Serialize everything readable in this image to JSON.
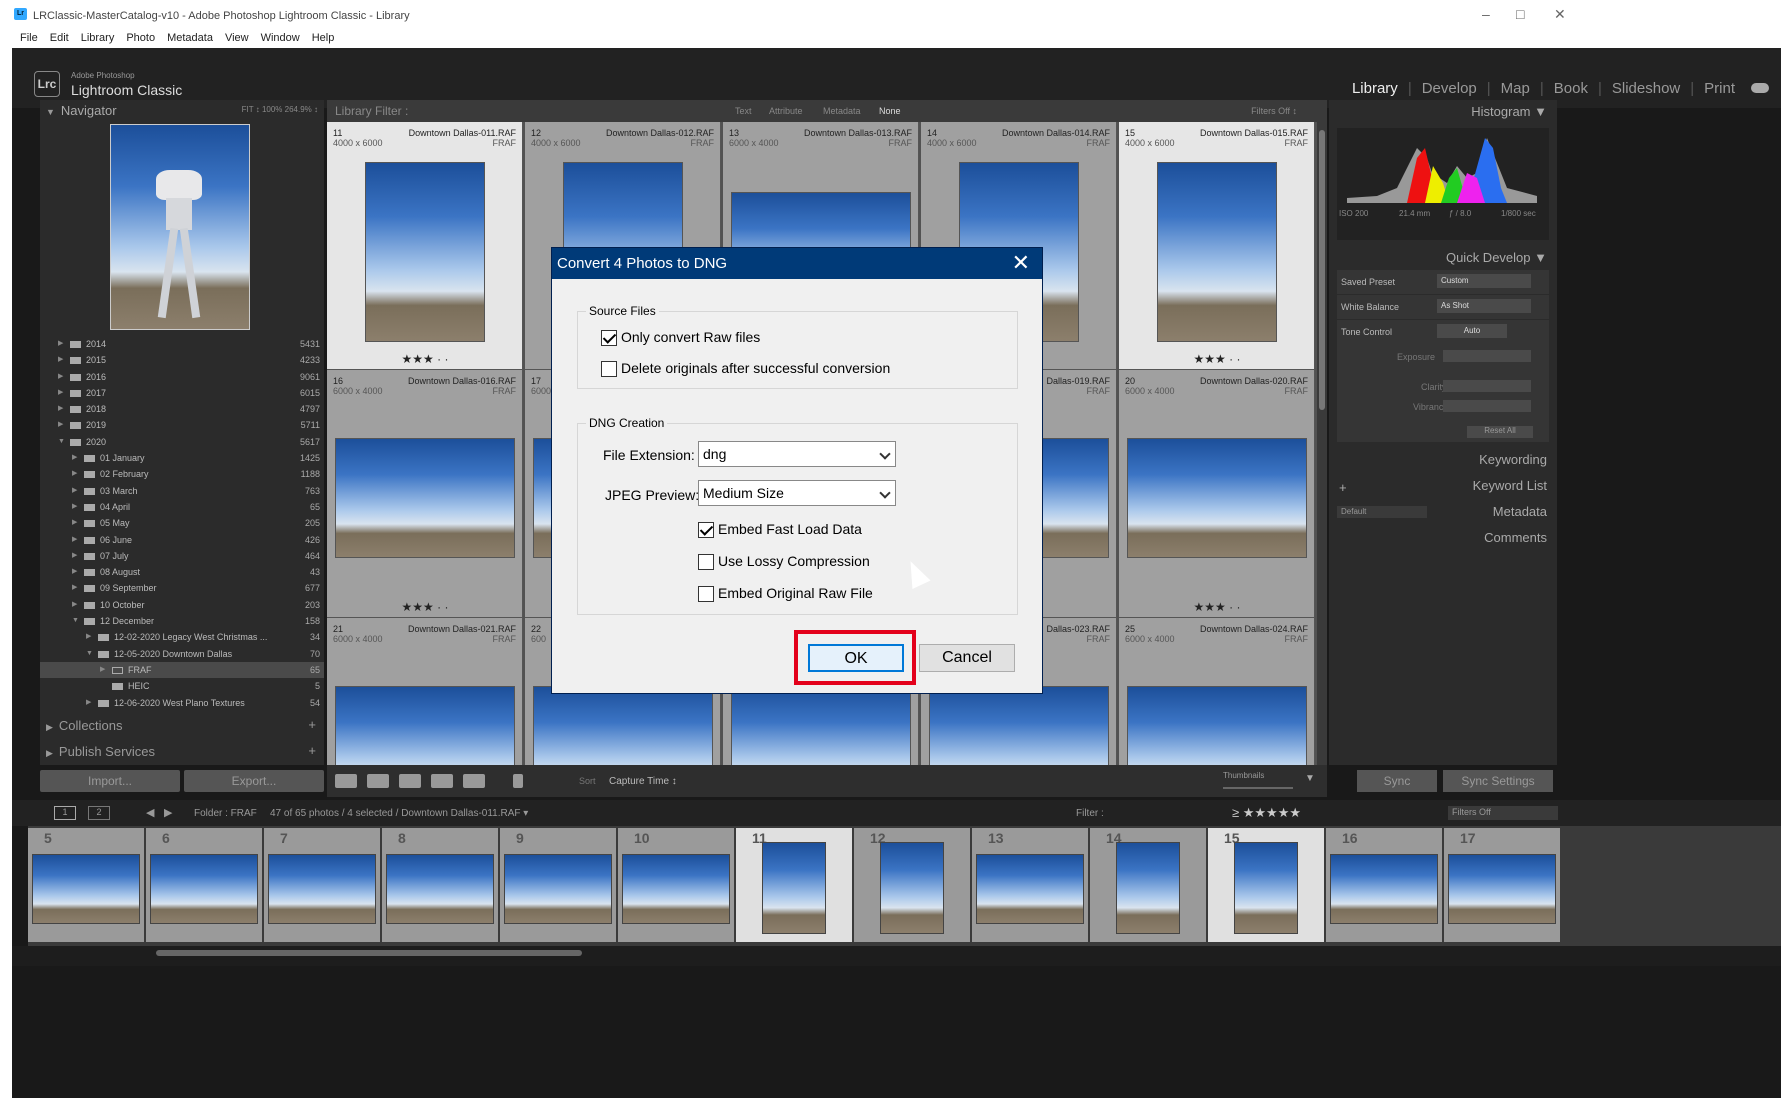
{
  "window": {
    "title": "LRClassic-MasterCatalog-v10 - Adobe Photoshop Lightroom Classic - Library",
    "minimize": "–",
    "maximize": "□",
    "close": "✕"
  },
  "menu": [
    "File",
    "Edit",
    "Library",
    "Photo",
    "Metadata",
    "View",
    "Window",
    "Help"
  ],
  "identity": {
    "small": "Adobe Photoshop",
    "big": "Lightroom Classic",
    "badge": "Lrc"
  },
  "modules": [
    "Library",
    "Develop",
    "Map",
    "Book",
    "Slideshow",
    "Print"
  ],
  "active_module": "Library",
  "navigator": {
    "label": "Navigator",
    "zoom": "FIT ↕  100%  264.9% ↕"
  },
  "folders": [
    {
      "label": "2014",
      "count": "5431",
      "level": 1
    },
    {
      "label": "2015",
      "count": "4233",
      "level": 1
    },
    {
      "label": "2016",
      "count": "9061",
      "level": 1
    },
    {
      "label": "2017",
      "count": "6015",
      "level": 1
    },
    {
      "label": "2018",
      "count": "4797",
      "level": 1
    },
    {
      "label": "2019",
      "count": "5711",
      "level": 1
    },
    {
      "label": "2020",
      "count": "5617",
      "level": 1
    },
    {
      "label": "01 January",
      "count": "1425",
      "level": 2
    },
    {
      "label": "02 February",
      "count": "1188",
      "level": 2
    },
    {
      "label": "03 March",
      "count": "763",
      "level": 2
    },
    {
      "label": "04 April",
      "count": "65",
      "level": 2
    },
    {
      "label": "05 May",
      "count": "205",
      "level": 2
    },
    {
      "label": "06 June",
      "count": "426",
      "level": 2
    },
    {
      "label": "07 July",
      "count": "464",
      "level": 2
    },
    {
      "label": "08 August",
      "count": "43",
      "level": 2
    },
    {
      "label": "09 September",
      "count": "677",
      "level": 2
    },
    {
      "label": "10 October",
      "count": "203",
      "level": 2
    },
    {
      "label": "12 December",
      "count": "158",
      "level": 2
    },
    {
      "label": "12-02-2020 Legacy West Christmas ...",
      "count": "34",
      "level": 3
    },
    {
      "label": "12-05-2020 Downtown Dallas",
      "count": "70",
      "level": 3
    },
    {
      "label": "FRAF",
      "count": "65",
      "level": 4
    },
    {
      "label": "HEIC",
      "count": "5",
      "level": 4
    },
    {
      "label": "12-06-2020 West Plano Textures",
      "count": "54",
      "level": 3
    }
  ],
  "left_panels": {
    "collections": "Collections",
    "publish": "Publish Services",
    "import": "Import...",
    "export": "Export..."
  },
  "library_filter": {
    "label": "Library Filter :",
    "tabs": [
      "Text",
      "Attribute",
      "Metadata",
      "None"
    ],
    "filters_off": "Filters Off ↕"
  },
  "grid": [
    {
      "num": "11",
      "dims": "4000 x 6000",
      "name": "Downtown Dallas-011.RAF",
      "type": "FRAF",
      "stars": "★★★ · ·",
      "state": "sel"
    },
    {
      "num": "12",
      "dims": "4000 x 6000",
      "name": "Downtown Dallas-012.RAF",
      "type": "FRAF",
      "stars": "",
      "state": "semi"
    },
    {
      "num": "13",
      "dims": "6000 x 4000",
      "name": "Downtown Dallas-013.RAF",
      "type": "FRAF",
      "stars": "",
      "state": "semi"
    },
    {
      "num": "14",
      "dims": "4000 x 6000",
      "name": "Downtown Dallas-014.RAF",
      "type": "FRAF",
      "stars": "",
      "state": "semi"
    },
    {
      "num": "15",
      "dims": "4000 x 6000",
      "name": "Downtown Dallas-015.RAF",
      "type": "FRAF",
      "stars": "★★★ · ·",
      "state": "sel"
    },
    {
      "num": "16",
      "dims": "6000 x 4000",
      "name": "Downtown Dallas-016.RAF",
      "type": "FRAF",
      "stars": "★★★ · ·",
      "state": "semi"
    },
    {
      "num": "17",
      "dims": "6000",
      "name": "",
      "type": "",
      "stars": "",
      "state": "semi"
    },
    {
      "num": "",
      "dims": "",
      "name": "",
      "type": "",
      "stars": "",
      "state": "semi"
    },
    {
      "num": "",
      "dims": "",
      "name": "Dallas-019.RAF",
      "type": "FRAF",
      "stars": "",
      "state": "semi"
    },
    {
      "num": "20",
      "dims": "6000 x 4000",
      "name": "Downtown Dallas-020.RAF",
      "type": "FRAF",
      "stars": "★★★ · ·",
      "state": "semi"
    },
    {
      "num": "21",
      "dims": "6000 x 4000",
      "name": "Downtown Dallas-021.RAF",
      "type": "FRAF",
      "stars": "",
      "state": "semi"
    },
    {
      "num": "22",
      "dims": "600",
      "name": "",
      "type": "",
      "stars": "",
      "state": "semi"
    },
    {
      "num": "",
      "dims": "",
      "name": "",
      "type": "",
      "stars": "",
      "state": "semi"
    },
    {
      "num": "",
      "dims": "",
      "name": "Dallas-023.RAF",
      "type": "FRAF",
      "stars": "",
      "state": "semi"
    },
    {
      "num": "25",
      "dims": "6000 x 4000",
      "name": "Downtown Dallas-024.RAF",
      "type": "FRAF",
      "stars": "",
      "state": "semi"
    }
  ],
  "toolbar": {
    "sort_label": "Sort",
    "sort_value": "Capture Time ↕",
    "thumbnails": "Thumbnails"
  },
  "right_panel": {
    "histogram": "Histogram",
    "info": [
      "ISO 200",
      "21.4 mm",
      "ƒ / 8.0",
      "1/800 sec"
    ],
    "quick_develop": "Quick Develop",
    "saved_preset_label": "Saved Preset",
    "saved_preset_value": "Custom",
    "white_balance_label": "White Balance",
    "white_balance_value": "As Shot",
    "tone_control_label": "Tone Control",
    "tone_control_value": "Auto",
    "exposure": "Exposure",
    "clarity": "Clarity",
    "vibrance": "Vibrance",
    "reset_all": "Reset All",
    "keywording": "Keywording",
    "keyword_list": "Keyword List",
    "metadata": "Metadata",
    "metadata_preset": "Default",
    "comments": "Comments",
    "sync": "Sync",
    "sync_settings": "Sync Settings"
  },
  "filmstrip": {
    "source": "Folder : FRAF",
    "count": "47 of 65 photos / 4 selected / Downtown Dallas-011.RAF ▾",
    "filter_label": "Filter :",
    "filters_off": "Filters Off",
    "pages": [
      "1",
      "2"
    ],
    "frames": [
      "5",
      "6",
      "7",
      "8",
      "9",
      "10",
      "11",
      "12",
      "13",
      "14",
      "15",
      "16",
      "17"
    ]
  },
  "dialog": {
    "title": "Convert 4 Photos to DNG",
    "close": "✕",
    "source_files_group": "Source Files",
    "only_raw": "Only convert Raw files",
    "only_raw_checked": true,
    "delete_originals": "Delete originals after successful conversion",
    "delete_originals_checked": false,
    "dng_creation_group": "DNG Creation",
    "file_ext_label": "File Extension:",
    "file_ext_value": "dng",
    "jpeg_preview_label": "JPEG Preview:",
    "jpeg_preview_value": "Medium Size",
    "embed_fast": "Embed Fast Load Data",
    "embed_fast_checked": true,
    "lossy": "Use Lossy Compression",
    "lossy_checked": false,
    "embed_raw": "Embed Original Raw File",
    "embed_raw_checked": false,
    "ok": "OK",
    "cancel": "Cancel"
  },
  "colors": {
    "dialog_title_bg": "#003a78",
    "highlight": "#e3001b",
    "ok_border": "#0078d7",
    "app_bg": "#191919"
  }
}
